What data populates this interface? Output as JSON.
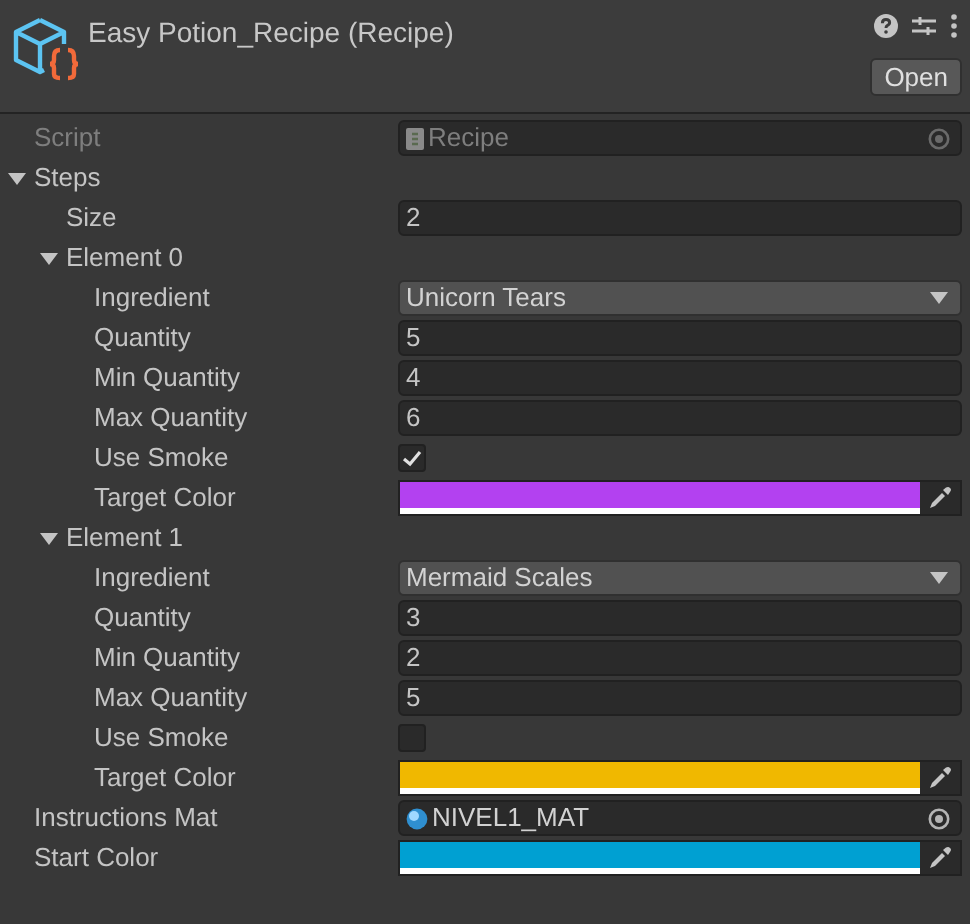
{
  "header": {
    "title": "Easy Potion_Recipe (Recipe)",
    "open_button": "Open"
  },
  "properties": [
    {
      "kind": "script",
      "label": "Script",
      "value": "Recipe",
      "disabled": true
    },
    {
      "kind": "foldout",
      "label": "Steps",
      "expanded": true,
      "children": [
        {
          "kind": "number",
          "label": "Size",
          "value": "2"
        },
        {
          "kind": "foldout",
          "label": "Element 0",
          "expanded": true,
          "children": [
            {
              "kind": "dropdown",
              "label": "Ingredient",
              "value": "Unicorn Tears"
            },
            {
              "kind": "number",
              "label": "Quantity",
              "value": "5"
            },
            {
              "kind": "number",
              "label": "Min Quantity",
              "value": "4"
            },
            {
              "kind": "number",
              "label": "Max Quantity",
              "value": "6"
            },
            {
              "kind": "checkbox",
              "label": "Use Smoke",
              "checked": true
            },
            {
              "kind": "color",
              "label": "Target Color",
              "color": "#b341f0"
            }
          ]
        },
        {
          "kind": "foldout",
          "label": "Element 1",
          "expanded": true,
          "children": [
            {
              "kind": "dropdown",
              "label": "Ingredient",
              "value": "Mermaid Scales"
            },
            {
              "kind": "number",
              "label": "Quantity",
              "value": "3"
            },
            {
              "kind": "number",
              "label": "Min Quantity",
              "value": "2"
            },
            {
              "kind": "number",
              "label": "Max Quantity",
              "value": "5"
            },
            {
              "kind": "checkbox",
              "label": "Use Smoke",
              "checked": false
            },
            {
              "kind": "color",
              "label": "Target Color",
              "color": "#f0b800"
            }
          ]
        }
      ]
    },
    {
      "kind": "object",
      "label": "Instructions Mat",
      "value": "NIVEL1_MAT",
      "disabled": false
    },
    {
      "kind": "color",
      "label": "Start Color",
      "color": "#00a0d2"
    }
  ]
}
